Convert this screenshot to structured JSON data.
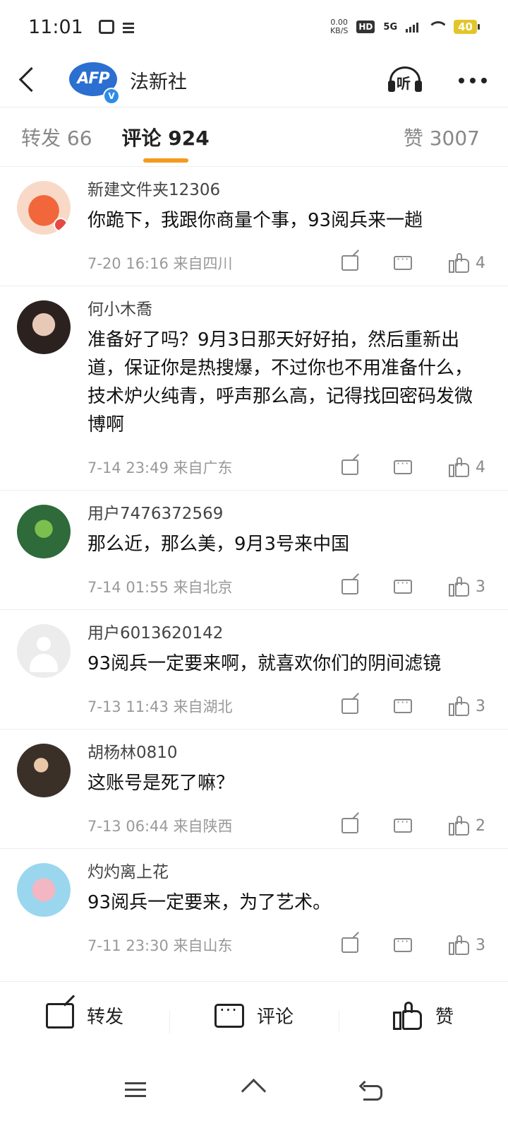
{
  "status_bar": {
    "time": "11:01",
    "net_speed_value": "0.00",
    "net_speed_unit": "KB/S",
    "hd": "HD",
    "network": "5G",
    "battery": "40"
  },
  "header": {
    "avatar_text": "AFP",
    "verified_badge": "V",
    "title": "法新社",
    "listen_label": "听"
  },
  "tabs": [
    {
      "label": "转发 66"
    },
    {
      "label": "评论 924"
    },
    {
      "label": "赞 3007"
    }
  ],
  "comments": [
    {
      "name": "新建文件夹12306",
      "text": "你跪下，我跟你商量个事，93阅兵来一趟",
      "meta": "7-20 16:16  来自四川",
      "likes": "4"
    },
    {
      "name": "何小木喬",
      "text": "准备好了吗？9月3日那天好好拍，然后重新出道，保证你是热搜爆，不过你也不用准备什么，技术炉火纯青，呼声那么高，记得找回密码发微博啊",
      "meta": "7-14 23:49  来自广东",
      "likes": "4"
    },
    {
      "name": "用户7476372569",
      "text": "那么近，那么美，9月3号来中国",
      "meta": "7-14 01:55  来自北京",
      "likes": "3"
    },
    {
      "name": "用户6013620142",
      "text": "93阅兵一定要来啊，就喜欢你们的阴间滤镜",
      "meta": "7-13 11:43  来自湖北",
      "likes": "3"
    },
    {
      "name": "胡杨林0810",
      "text": "这账号是死了嘛？",
      "meta": "7-13 06:44  来自陕西",
      "likes": "2"
    },
    {
      "name": "灼灼离上花",
      "text": "93阅兵一定要来，为了艺术。",
      "meta": "7-11 23:30  来自山东",
      "likes": "3"
    }
  ],
  "action_bar": {
    "repost": "转发",
    "comment": "评论",
    "like": "赞"
  },
  "colors": {
    "accent": "#f29b1d",
    "brand_blue": "#2b6fd0",
    "text_primary": "#111111",
    "text_secondary": "#999999"
  },
  "icons": [
    "back-arrow-icon",
    "listen-icon",
    "more-icon",
    "share-icon",
    "comment-icon",
    "like-icon",
    "menu-icon",
    "home-icon",
    "return-icon"
  ]
}
